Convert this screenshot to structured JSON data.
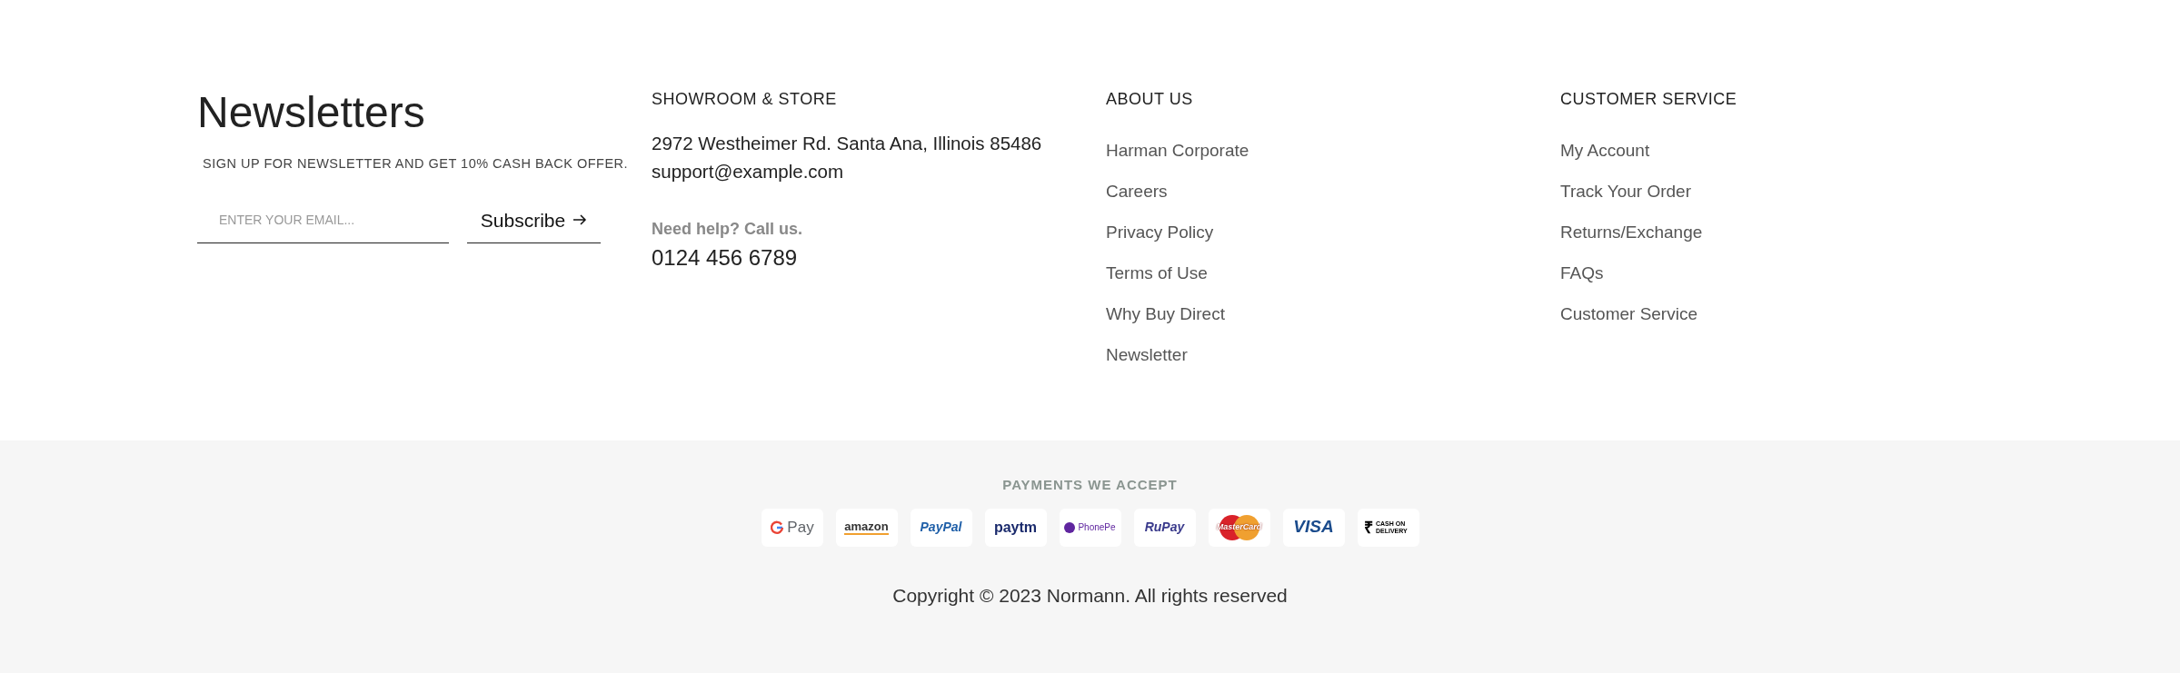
{
  "newsletter": {
    "title": "Newsletters",
    "subtitle": "SIGN UP FOR NEWSLETTER AND GET 10% CASH BACK OFFER.",
    "email": {
      "placeholder": "ENTER YOUR EMAIL..."
    },
    "button": "Subscribe"
  },
  "showroom": {
    "heading": "SHOWROOM & STORE",
    "address": "2972 Westheimer Rd. Santa Ana, Illinois 85486",
    "email": "support@example.com",
    "help": "Need help? Call us.",
    "phone": "0124 456 6789"
  },
  "link_columns": [
    {
      "heading": "ABOUT US",
      "links": [
        "Harman Corporate",
        "Careers",
        "Privacy Policy",
        "Terms of Use",
        "Why Buy Direct",
        "Newsletter"
      ]
    },
    {
      "heading": "CUSTOMER SERVICE",
      "links": [
        "My Account",
        "Track Your Order",
        "Returns/Exchange",
        "FAQs",
        "Customer Service"
      ]
    }
  ],
  "payments": {
    "heading": "PAYMENTS WE ACCEPT",
    "methods": [
      {
        "kind": "gpay",
        "label": "Pay"
      },
      {
        "kind": "amazon",
        "label": "amazon"
      },
      {
        "kind": "paypal",
        "label": "PayPal"
      },
      {
        "kind": "paytm",
        "label": "paytm"
      },
      {
        "kind": "phonepe",
        "label": "PhonePe"
      },
      {
        "kind": "rupay",
        "label": "RuPay"
      },
      {
        "kind": "mastercard",
        "label": "MasterCard"
      },
      {
        "kind": "visa",
        "label": "VISA"
      },
      {
        "kind": "cod",
        "symbol": "₹",
        "label": "CASH ON DELIVERY"
      }
    ]
  },
  "copyright": "Copyright © 2023 Normann. All rights reserved"
}
